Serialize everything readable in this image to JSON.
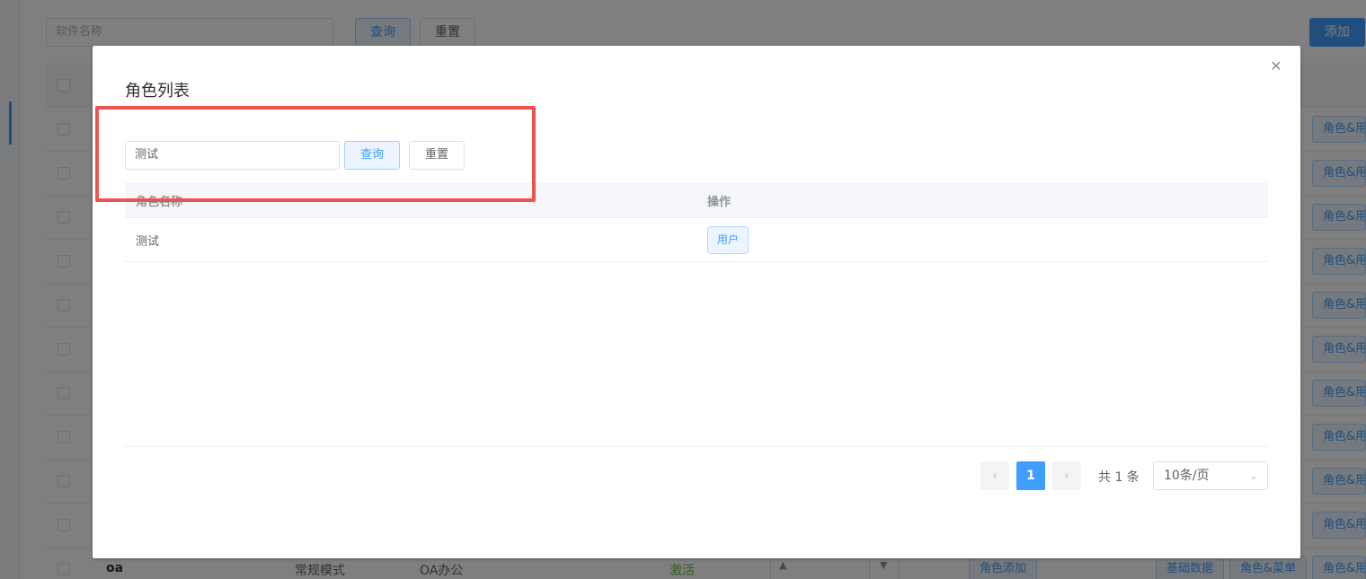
{
  "background": {
    "search_placeholder": "软件名称",
    "query_label": "查询",
    "reset_label": "重置",
    "add_label": "添加",
    "row_action_label": "角色&用户",
    "last_row": {
      "code": "oa",
      "mode": "常规模式",
      "name": "OA办公",
      "status": "激活",
      "role_add_label": "角色添加",
      "basic_data_label": "基础数据",
      "role_menu_label": "角色&菜单",
      "role_user_label": "角色&用户"
    }
  },
  "dialog": {
    "title": "角色列表",
    "search": {
      "value": "测试",
      "query_label": "查询",
      "reset_label": "重置"
    },
    "table": {
      "columns": [
        "角色名称",
        "操作"
      ],
      "rows": [
        {
          "name": "测试",
          "action_label": "用户"
        }
      ]
    },
    "pagination": {
      "current_page": "1",
      "total_text": "共 1 条",
      "page_size": "10条/页"
    }
  },
  "colors": {
    "primary": "#409eff",
    "highlight": "#ef5350",
    "active_status": "#67c23a"
  }
}
